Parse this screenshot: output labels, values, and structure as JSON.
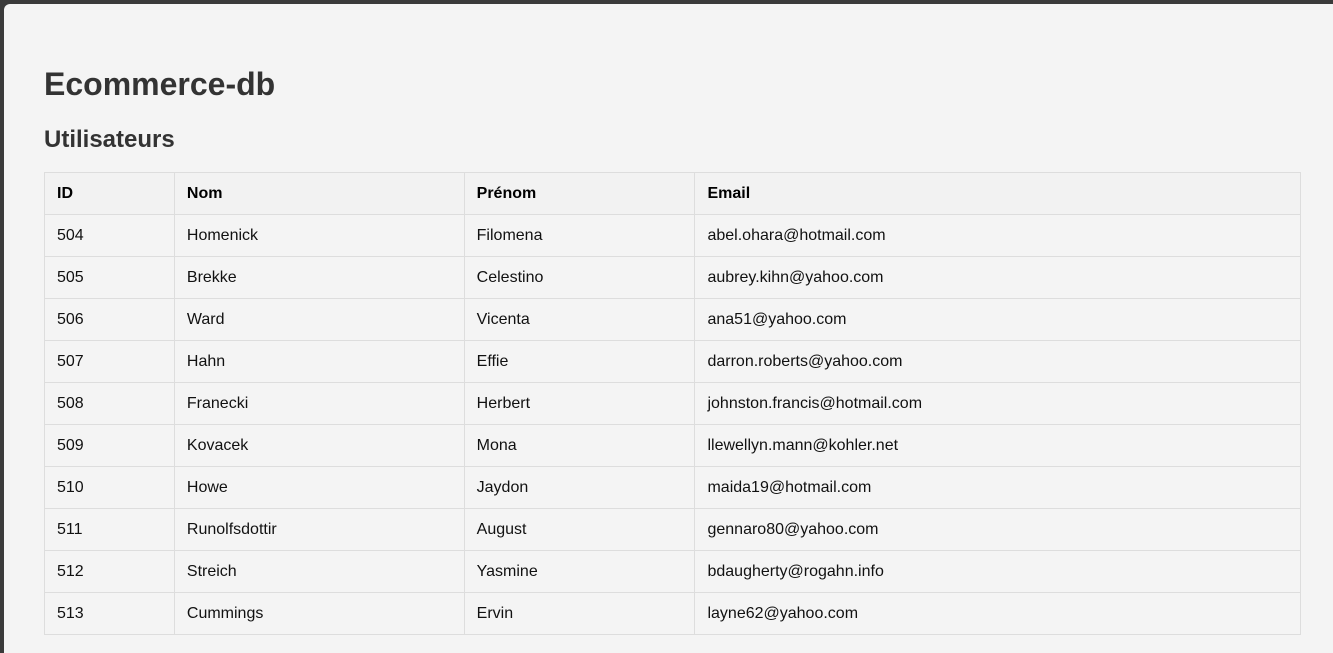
{
  "page": {
    "title": "Ecommerce-db",
    "section_title": "Utilisateurs"
  },
  "table": {
    "headers": [
      "ID",
      "Nom",
      "Prénom",
      "Email"
    ],
    "rows": [
      [
        "504",
        "Homenick",
        "Filomena",
        "abel.ohara@hotmail.com"
      ],
      [
        "505",
        "Brekke",
        "Celestino",
        "aubrey.kihn@yahoo.com"
      ],
      [
        "506",
        "Ward",
        "Vicenta",
        "ana51@yahoo.com"
      ],
      [
        "507",
        "Hahn",
        "Effie",
        "darron.roberts@yahoo.com"
      ],
      [
        "508",
        "Franecki",
        "Herbert",
        "johnston.francis@hotmail.com"
      ],
      [
        "509",
        "Kovacek",
        "Mona",
        "llewellyn.mann@kohler.net"
      ],
      [
        "510",
        "Howe",
        "Jaydon",
        "maida19@hotmail.com"
      ],
      [
        "511",
        "Runolfsdottir",
        "August",
        "gennaro80@yahoo.com"
      ],
      [
        "512",
        "Streich",
        "Yasmine",
        "bdaugherty@rogahn.info"
      ],
      [
        "513",
        "Cummings",
        "Ervin",
        "layne62@yahoo.com"
      ]
    ]
  },
  "colors": {
    "background": "#f4f4f4",
    "heading": "#333333",
    "border": "#dddddd",
    "header_bg": "#f2f2f2"
  }
}
